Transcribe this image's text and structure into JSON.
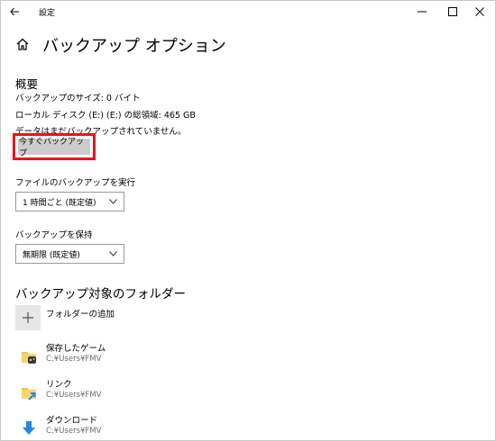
{
  "window": {
    "title": "設定"
  },
  "page": {
    "title": "バックアップ オプション"
  },
  "overview": {
    "heading": "概要",
    "backup_size": "バックアップのサイズ: 0 バイト",
    "disk_total": "ローカル ディスク (E:) (E:) の総領域: 465 GB",
    "not_backed_up": "データはまだバックアップされていません。",
    "backup_now_label": "今すぐバックアップ"
  },
  "schedule": {
    "label": "ファイルのバックアップを実行",
    "selected": "1 時間ごと (既定値)"
  },
  "retention": {
    "label": "バックアップを保持",
    "selected": "無期限 (既定値)"
  },
  "folders": {
    "heading": "バックアップ対象のフォルダー",
    "add_label": "フォルダーの追加",
    "items": [
      {
        "name": "保存したゲーム",
        "path": "C:¥Users¥FMV",
        "icon": "saved-games-folder-icon"
      },
      {
        "name": "リンク",
        "path": "C:¥Users¥FMV",
        "icon": "links-folder-icon"
      },
      {
        "name": "ダウンロード",
        "path": "C:¥Users¥FMV",
        "icon": "download-arrow-icon"
      }
    ]
  },
  "colors": {
    "highlight": "#e8161b",
    "button_bg": "#cccccc",
    "accent_blue": "#1e88e5",
    "folder_yellow": "#f3c74a"
  }
}
